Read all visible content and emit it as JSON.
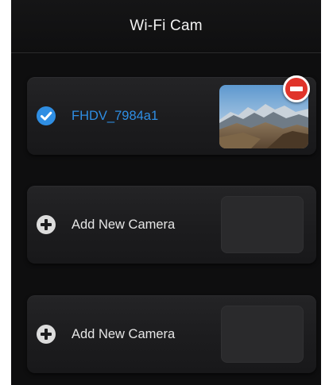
{
  "navbar": {
    "title": "Wi-Fi Cam"
  },
  "cameras": [
    {
      "label": "FHDV_7984a1",
      "status": "connected",
      "icon": "checkmark-icon",
      "has_thumbnail": true,
      "remove_icon": "minus-circle-icon"
    },
    {
      "label": "Add New Camera",
      "status": "empty",
      "icon": "plus-circle-icon",
      "has_thumbnail": false
    },
    {
      "label": "Add New Camera",
      "status": "empty",
      "icon": "plus-circle-icon",
      "has_thumbnail": false
    }
  ],
  "colors": {
    "background": "#0e0e0f",
    "card": "#1e1e20",
    "accent_blue": "#2f8ee3",
    "remove_red": "#e0342b",
    "text": "#e6e6e6"
  }
}
